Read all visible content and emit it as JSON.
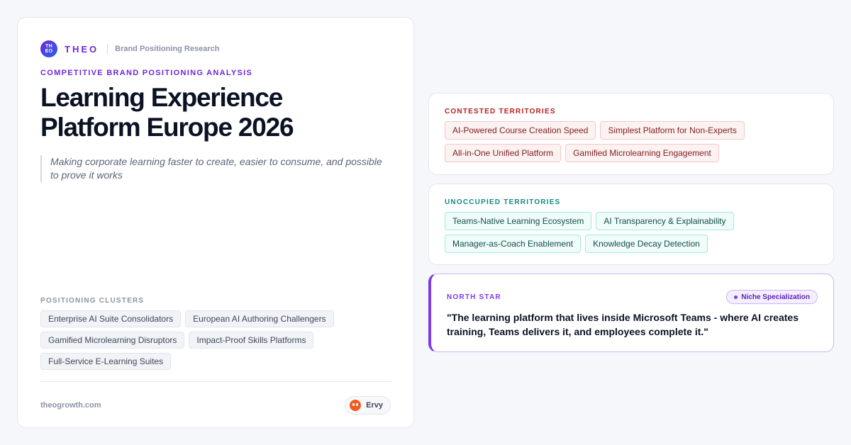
{
  "brand": {
    "logo_text_top": "TH",
    "logo_text_bottom": "EO",
    "name": "THEO",
    "subtitle": "Brand Positioning Research"
  },
  "hero": {
    "eyebrow": "COMPETITIVE BRAND POSITIONING ANALYSIS",
    "title": "Learning Experience Platform Europe 2026",
    "tagline": "Making corporate learning faster to create, easier to consume, and possible to prove it works"
  },
  "clusters": {
    "label": "POSITIONING CLUSTERS",
    "items": [
      "Enterprise AI Suite Consolidators",
      "European AI Authoring Challengers",
      "Gamified Microlearning Disruptors",
      "Impact-Proof Skills Platforms",
      "Full-Service E-Learning Suites"
    ]
  },
  "footer": {
    "url": "theogrowth.com",
    "badge": "Ervy"
  },
  "contested": {
    "label": "CONTESTED TERRITORIES",
    "items": [
      "AI-Powered Course Creation Speed",
      "Simplest Platform for Non-Experts",
      "All-in-One Unified Platform",
      "Gamified Microlearning Engagement"
    ]
  },
  "unoccupied": {
    "label": "UNOCCUPIED TERRITORIES",
    "items": [
      "Teams-Native Learning Ecosystem",
      "AI Transparency & Explainability",
      "Manager-as-Coach Enablement",
      "Knowledge Decay Detection"
    ]
  },
  "north_star": {
    "label": "NORTH STAR",
    "badge": "Niche Specialization",
    "quote": "\"The learning platform that lives inside Microsoft Teams - where AI creates training, Teams delivers it, and employees complete it.\""
  },
  "colors": {
    "accent": "#6d28d9",
    "contested": "#b91c1c",
    "unoccupied": "#0f8a85",
    "north_star": "#7c3aed"
  }
}
